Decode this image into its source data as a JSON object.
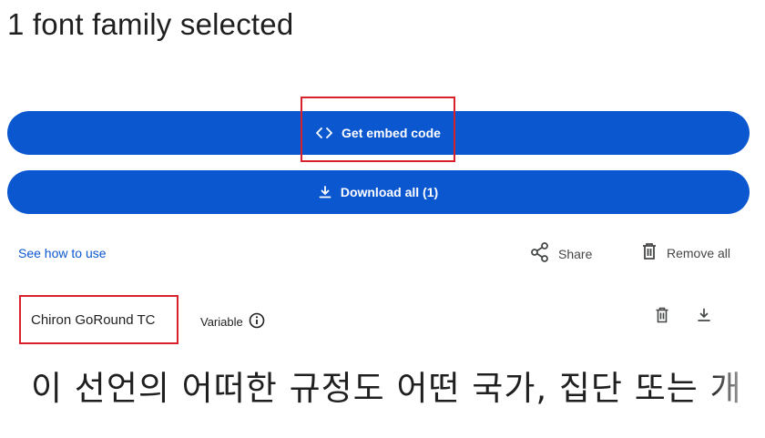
{
  "header": {
    "title": "1 font family selected"
  },
  "actions": {
    "embed_label": "Get embed code",
    "download_label": "Download all (1)"
  },
  "links": {
    "see_how": "See how to use",
    "share": "Share",
    "remove_all": "Remove all"
  },
  "font_item": {
    "name": "Chiron GoRound TC",
    "variable_label": "Variable",
    "preview_text": "이 선언의 어떠한 규정도 어떤 국가, 집단 또는 개"
  },
  "icons": {
    "embed": "code-icon",
    "download": "download-icon",
    "share": "share-icon",
    "remove": "trash-icon",
    "info": "info-icon"
  },
  "colors": {
    "accent": "#0b57d0",
    "link": "#0b57d0",
    "highlight": "#d9212b"
  }
}
